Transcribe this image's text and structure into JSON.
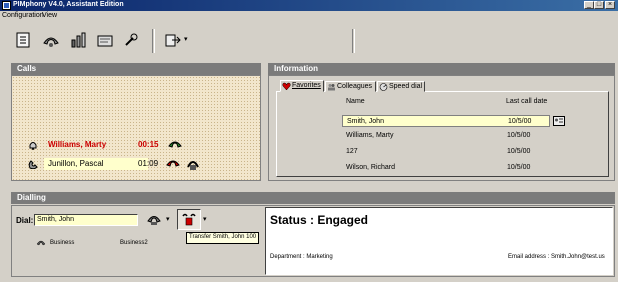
{
  "window": {
    "title": "PIMphony V4.0, Assistant Edition"
  },
  "menu": {
    "items": [
      {
        "label": "Configuration"
      },
      {
        "label": "View"
      }
    ]
  },
  "toolbar": {
    "icons": [
      "phone-book-icon",
      "call-forward-icon",
      "statistics-icon",
      "directory-icon",
      "tools-icon",
      "transfer-menu-icon"
    ],
    "dropdown_glyph": "▾"
  },
  "calls": {
    "header": "Calls",
    "rows": [
      {
        "name": "Williams, Marty",
        "time": "00:15",
        "state": "ringing",
        "color": "#cc0000"
      },
      {
        "name": "Junillon, Pascal",
        "time": "01:09",
        "state": "connected",
        "color": "#000000"
      }
    ]
  },
  "information": {
    "header": "Information",
    "tabs": [
      {
        "label": "Favorites"
      },
      {
        "label": "Colleagues"
      },
      {
        "label": "Speed dial"
      }
    ],
    "columns": {
      "name": "Name",
      "last_call": "Last call date"
    },
    "rows": [
      {
        "name": "Smith, John",
        "date": "10/5/00",
        "selected": true
      },
      {
        "name": "Williams, Marty",
        "date": "10/5/00",
        "selected": false
      },
      {
        "name": "127",
        "date": "10/5/00",
        "selected": false
      },
      {
        "name": "Wilson, Richard",
        "date": "10/5/00",
        "selected": false
      }
    ]
  },
  "dialling": {
    "header": "Dialling",
    "dial_label": "Dial:",
    "dial_value": "Smith, John",
    "numbers": [
      {
        "label": "Business"
      },
      {
        "label": "Business2"
      }
    ],
    "tooltip": "Transfer Smith, John 100",
    "status": "Status : Engaged",
    "department": "Department : Marketing",
    "email": "Email address : Smith.John@test.us"
  },
  "colors": {
    "selected_row": "#ffffcc",
    "panel_header": "#7b7b7b",
    "title_bar": "#0a246a"
  }
}
